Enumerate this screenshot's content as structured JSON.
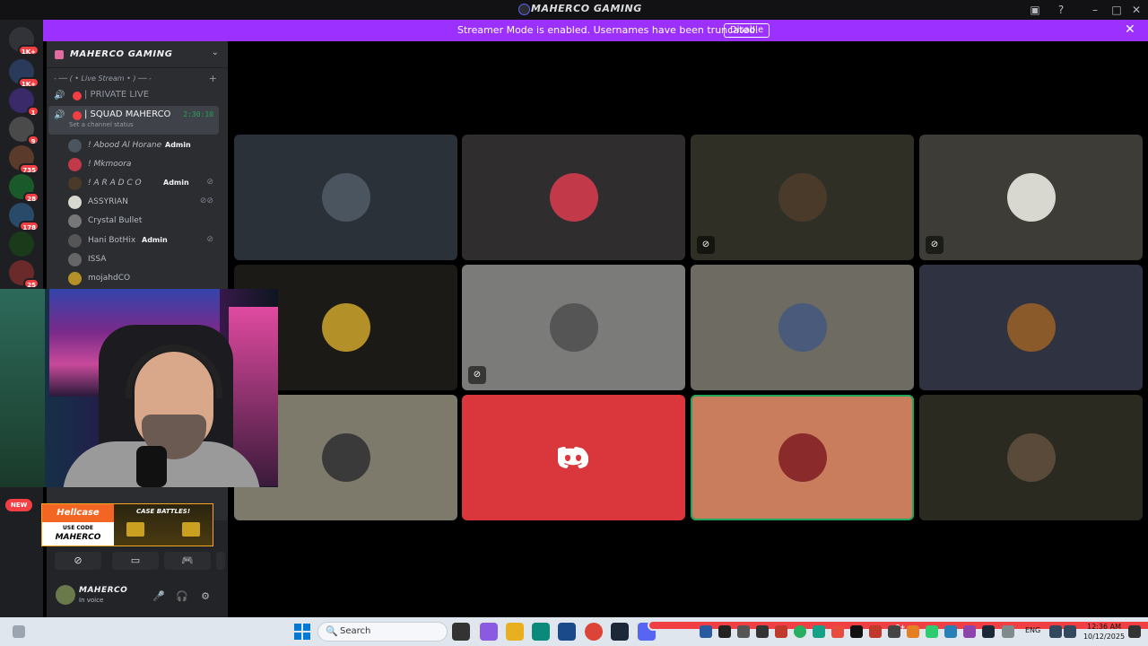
{
  "window": {
    "title": "MAHERCO GAMING"
  },
  "banner": {
    "message": "Streamer Mode is enabled. Usernames have been truncated.",
    "disable_label": "Disable",
    "color": "#9b30ff"
  },
  "server_badges": [
    "1K+",
    "1K+",
    "1",
    "9",
    "735",
    "28",
    "178",
    "25"
  ],
  "guild": {
    "name": "MAHERCO GAMING"
  },
  "category": {
    "label": "- ── ( • Live Stream • ) ── -"
  },
  "voice_channels": [
    {
      "label": "| PRIVATE LIVE"
    },
    {
      "label": "| SQUAD MAHERCO",
      "timer": "2:30:10",
      "status": "Set a channel status"
    }
  ],
  "members": [
    {
      "name": "! Abood Al Horane",
      "badge": "Admin"
    },
    {
      "name": "! Mkmoora"
    },
    {
      "name": "! A R A D C O",
      "badge": "Admin"
    },
    {
      "name": "ASSYRIAN"
    },
    {
      "name": "Crystal Bullet"
    },
    {
      "name": "Hani BotHix",
      "badge": "Admin"
    },
    {
      "name": "ISSA"
    },
    {
      "name": "mojahdCO"
    }
  ],
  "promo": {
    "new_label": "NEW",
    "brand": "Hellcase",
    "use_code": "USE CODE",
    "code": "MAHERCO",
    "tagline": "CASE BATTLES!"
  },
  "user": {
    "name": "MAHERCO",
    "status": "In voice"
  },
  "tiles": [
    {
      "bg": "#2b3138",
      "avatar": "#4a5560"
    },
    {
      "bg": "#2f2d2e",
      "avatar": "#c23a4a"
    },
    {
      "bg": "#2f2f25",
      "avatar": "#4a3a2a"
    },
    {
      "bg": "#3d3c37",
      "avatar": "#d8d8d0"
    },
    {
      "bg": "#1c1a16",
      "avatar": "#b39028"
    },
    {
      "bg": "#7b7b79",
      "avatar": "#555"
    },
    {
      "bg": "#6d6b62",
      "avatar": "#4a5a7a"
    },
    {
      "bg": "#2e3241",
      "avatar": "#8a5a2a"
    },
    {
      "bg": "#7d7a6c",
      "avatar": "#3a3a3a"
    },
    {
      "bg": "#da373c",
      "avatar": "#da373c"
    },
    {
      "bg": "#c97d5c",
      "avatar": "#8a2a2a"
    },
    {
      "bg": "#2b2a20",
      "avatar": "#5a4a3a"
    }
  ],
  "taskbar": {
    "search_placeholder": "Search",
    "language": "ENG",
    "time": "12:36 AM",
    "date": "10/12/2025",
    "discord_badge": "9+"
  }
}
